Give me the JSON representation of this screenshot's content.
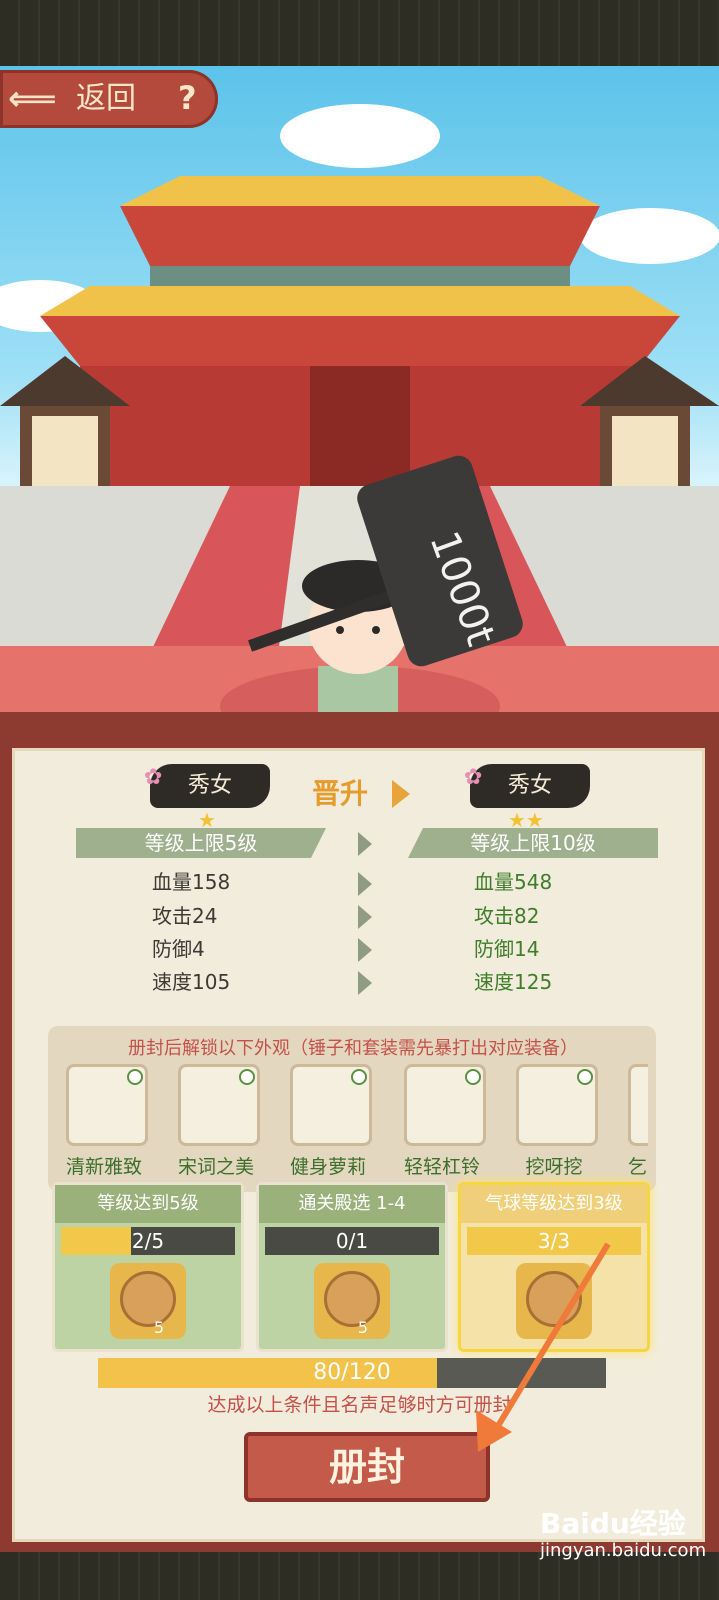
{
  "header": {
    "back_label": "返回",
    "help_label": "?"
  },
  "rank": {
    "current": {
      "name": "秀女",
      "stars": "★"
    },
    "next": {
      "name": "秀女",
      "stars": "★★"
    },
    "promote_label": "晋升"
  },
  "level_cap": {
    "current": "等级上限5级",
    "next": "等级上限10级"
  },
  "stats": {
    "current": [
      "血量158",
      "攻击24",
      "防御4",
      "速度105"
    ],
    "next": [
      "血量548",
      "攻击82",
      "防御14",
      "速度125"
    ]
  },
  "unlock": {
    "title": "册封后解锁以下外观（锤子和套装需先暴打出对应装备）",
    "items": [
      {
        "label": "清新雅致"
      },
      {
        "label": "宋词之美"
      },
      {
        "label": "健身萝莉"
      },
      {
        "label": "轻轻杠铃"
      },
      {
        "label": "挖呀挖"
      },
      {
        "label": "乞"
      }
    ]
  },
  "tasks": [
    {
      "title": "等级达到5级",
      "progress_text": "2/5",
      "progress": 0.4,
      "reward_qty": "5"
    },
    {
      "title": "通关殿选 1-4",
      "progress_text": "0/1",
      "progress": 0,
      "reward_qty": "5"
    },
    {
      "title": "气球等级达到3级",
      "progress_text": "3/3",
      "progress": 1,
      "reward_qty": ""
    }
  ],
  "overall": {
    "progress_text": "80/120",
    "progress": 0.667
  },
  "hint": "达成以上条件且名声足够时方可册封",
  "seal_button": "册封",
  "hammer_text": "1000t",
  "watermark": {
    "main": "Baidu经验",
    "sub": "jingyan.baidu.com"
  },
  "colors": {
    "accent_red": "#b44a3c",
    "green_text": "#3f7d2a",
    "gold": "#f2c24b"
  }
}
